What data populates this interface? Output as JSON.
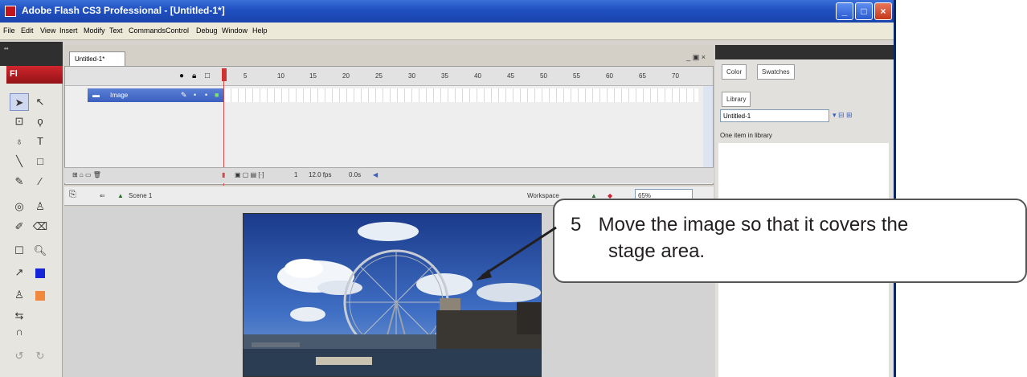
{
  "window": {
    "title": "Adobe Flash CS3 Professional - [Untitled-1*]",
    "controls": [
      "minimize",
      "maximize",
      "close"
    ]
  },
  "menubar": {
    "items": [
      "File",
      "Edit",
      "View",
      "Insert",
      "Modify",
      "Text",
      "Commands",
      "Control",
      "Debug",
      "Window",
      "Help"
    ]
  },
  "tools": {
    "logo": "Fl",
    "icons": [
      "selection-tool-icon",
      "subselection-tool-icon",
      "free-transform-icon",
      "lasso-icon",
      "pen-icon",
      "text-icon",
      "line-icon",
      "rectangle-icon",
      "pencil-icon",
      "brush-icon",
      "ink-bottle-icon",
      "paint-bucket-icon",
      "eyedropper-icon",
      "eraser-icon",
      "hand-icon",
      "zoom-icon",
      "stroke-color-icon",
      "fill-color-icon",
      "swap-colors-icon",
      "snap-icon"
    ]
  },
  "document": {
    "tab_label": "Untitled-1*"
  },
  "timeline": {
    "frame_numbers": [
      "5",
      "10",
      "15",
      "20",
      "25",
      "30",
      "35",
      "40",
      "45",
      "50",
      "55",
      "60",
      "65",
      "70"
    ],
    "layer_name": "Image",
    "current_frame": "1",
    "frame_rate": "12.0 fps",
    "elapsed": "0.0s"
  },
  "editbar": {
    "scene_label": "Scene 1",
    "workspace_label": "Workspace",
    "zoom_value": "65%"
  },
  "panels": {
    "color_tab": "Color",
    "swatches_tab": "Swatches",
    "library_tab": "Library",
    "library_select": "Untitled-1",
    "library_count": "One item in library"
  },
  "callout": {
    "number": "5",
    "line1": "Move the image so that it covers the",
    "line2": "stage area."
  }
}
